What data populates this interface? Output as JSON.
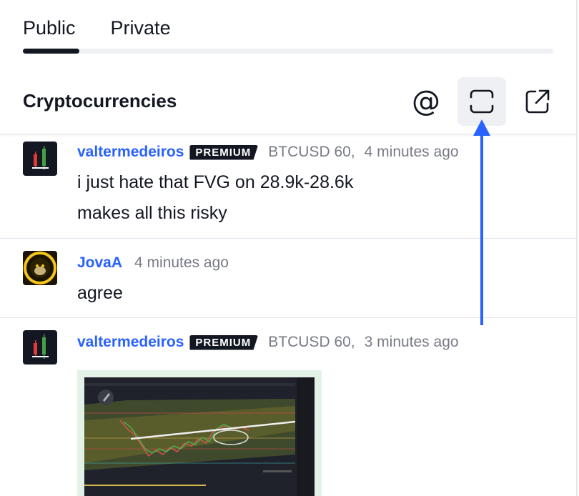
{
  "tabs": [
    {
      "label": "Public",
      "active": true
    },
    {
      "label": "Private",
      "active": false
    }
  ],
  "header": {
    "title": "Cryptocurrencies",
    "mention_glyph": "@",
    "icons": [
      "at-icon",
      "fullscreen-icon",
      "popout-icon"
    ]
  },
  "messages": [
    {
      "username": "valtermedeiros",
      "badge": "PREMIUM",
      "symbol": "BTCUSD 60,",
      "time": "4 minutes ago",
      "lines": [
        "i just hate that FVG on 28.9k-28.6k",
        "makes all this risky"
      ]
    },
    {
      "username": "JovaA",
      "time": "4 minutes ago",
      "lines": [
        "agree"
      ]
    },
    {
      "username": "valtermedeiros",
      "badge": "PREMIUM",
      "symbol": "BTCUSD 60,",
      "time": "3 minutes ago",
      "lines": []
    }
  ],
  "colors": {
    "accent": "#2962ff",
    "text": "#131722",
    "muted": "#787b86",
    "badge_bg": "#131722",
    "button_bg": "#eef0f4",
    "annotation_arrow": "#2962ff"
  }
}
